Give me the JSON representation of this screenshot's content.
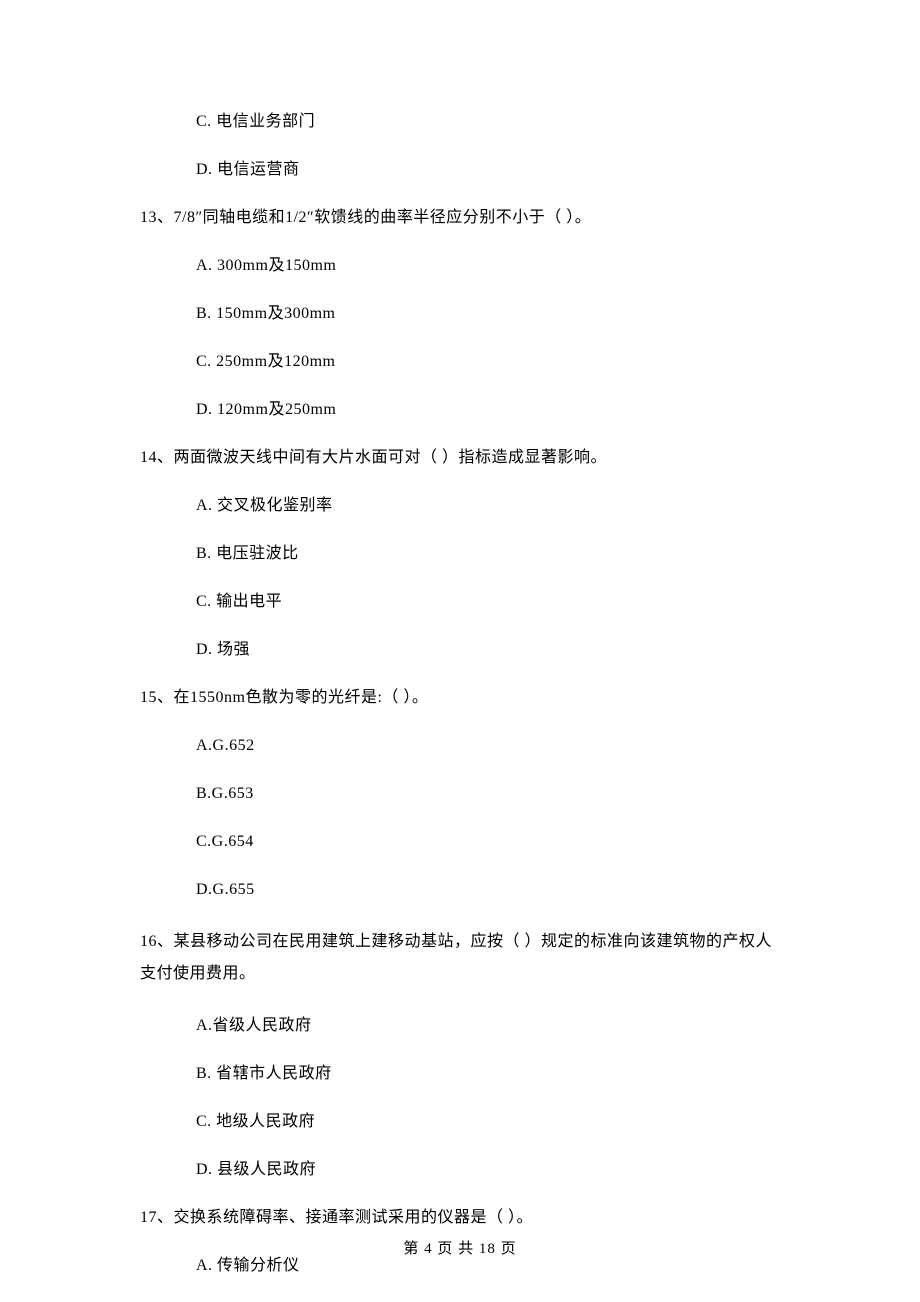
{
  "leading_options": {
    "c": "C.  电信业务部门",
    "d": "D.  电信运营商"
  },
  "q13": {
    "stem": "13、7/8″同轴电缆和1/2″软馈线的曲率半径应分别不小于（     ）。",
    "a": "A.  300mm及150mm",
    "b": "B.  150mm及300mm",
    "c": "C.  250mm及120mm",
    "d": "D.  120mm及250mm"
  },
  "q14": {
    "stem": "14、两面微波天线中间有大片水面可对（     ）指标造成显著影响。",
    "a": "A.  交叉极化鉴别率",
    "b": "B.  电压驻波比",
    "c": "C.  输出电平",
    "d": "D.  场强"
  },
  "q15": {
    "stem": "15、在1550nm色散为零的光纤是:（     ）。",
    "a": "A.G.652",
    "b": "B.G.653",
    "c": "C.G.654",
    "d": "D.G.655"
  },
  "q16": {
    "stem": "16、某县移动公司在民用建筑上建移动基站，应按（     ）规定的标准向该建筑物的产权人支付使用费用。",
    "a": "A.省级人民政府",
    "b": "B.  省辖市人民政府",
    "c": "C.  地级人民政府",
    "d": "D.  县级人民政府"
  },
  "q17": {
    "stem": "17、交换系统障碍率、接通率测试采用的仪器是（     ）。",
    "a": "A.  传输分析仪"
  },
  "footer": "第 4 页 共 18 页"
}
